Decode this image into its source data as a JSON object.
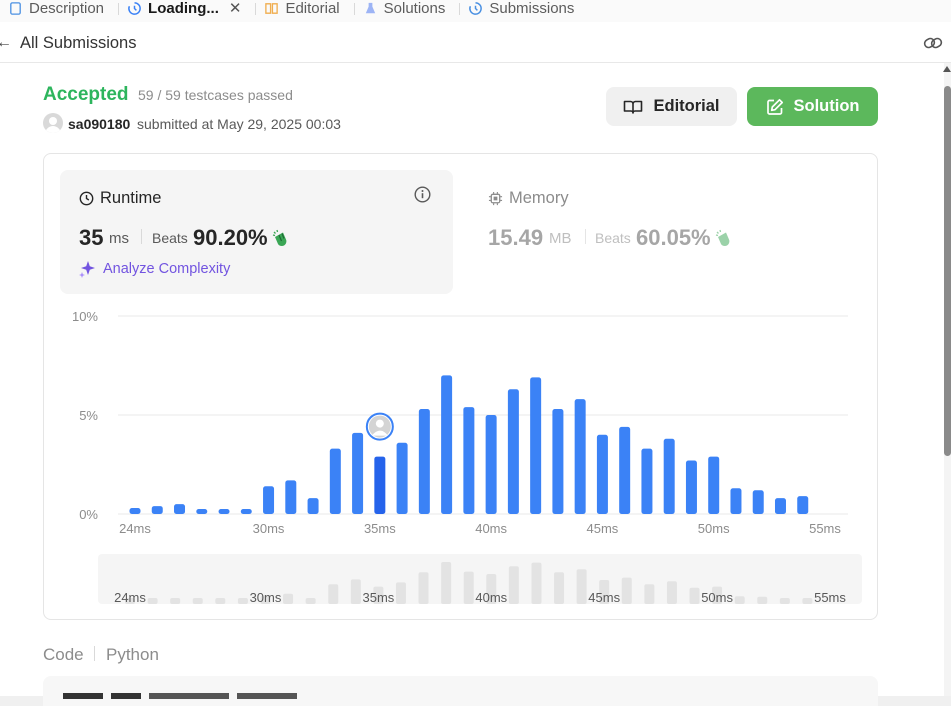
{
  "tabs": [
    {
      "label": "Description",
      "icon": "document-icon",
      "active": false
    },
    {
      "label": "Loading...",
      "icon": "history-icon",
      "active": true
    },
    {
      "label": "Editorial",
      "icon": "book-icon",
      "active": false
    },
    {
      "label": "Solutions",
      "icon": "flask-icon",
      "active": false
    },
    {
      "label": "Submissions",
      "icon": "history-icon",
      "active": false
    }
  ],
  "header": {
    "back_label": "All Submissions"
  },
  "submission": {
    "status": "Accepted",
    "testcases": "59 / 59 testcases passed",
    "user": "sa090180",
    "submitted": "submitted at May 29, 2025 00:03"
  },
  "buttons": {
    "editorial": "Editorial",
    "solution": "Solution"
  },
  "runtime": {
    "title": "Runtime",
    "value": "35",
    "unit": "ms",
    "beats_label": "Beats",
    "beats_pct": "90.20%",
    "analyze_label": "Analyze Complexity"
  },
  "memory": {
    "title": "Memory",
    "value": "15.49",
    "unit": "MB",
    "beats_label": "Beats",
    "beats_pct": "60.05%"
  },
  "code": {
    "label": "Code",
    "language": "Python"
  },
  "colors": {
    "accepted": "#2db55d",
    "bar": "#3b82f6",
    "bar_highlight": "#2563eb",
    "solution_btn": "#5cb85c",
    "analyze": "#7254e0"
  },
  "chart_data": {
    "type": "bar",
    "x": [
      24,
      25,
      26,
      27,
      28,
      29,
      30,
      31,
      32,
      33,
      34,
      35,
      36,
      37,
      38,
      39,
      40,
      41,
      42,
      43,
      44,
      45,
      46,
      47,
      48,
      49,
      50,
      51,
      52,
      53,
      54,
      55
    ],
    "values": [
      0.3,
      0.4,
      0.5,
      0.25,
      0.25,
      0.25,
      1.4,
      1.7,
      0.8,
      3.3,
      4.1,
      2.9,
      3.6,
      5.3,
      7.0,
      5.4,
      5.0,
      6.3,
      6.9,
      5.3,
      5.8,
      4.0,
      4.4,
      3.3,
      3.8,
      2.7,
      2.9,
      1.3,
      1.2,
      0.8,
      0.9,
      0.0
    ],
    "highlight_x": 35,
    "x_ticks": [
      24,
      30,
      35,
      40,
      45,
      50,
      55
    ],
    "x_tick_labels": [
      "24ms",
      "30ms",
      "35ms",
      "40ms",
      "45ms",
      "50ms",
      "55ms"
    ],
    "y_ticks": [
      0,
      5,
      10
    ],
    "y_tick_labels": [
      "0%",
      "5%",
      "10%"
    ],
    "ylim": [
      0,
      10
    ],
    "xlim": [
      24,
      55
    ],
    "grid": true
  }
}
